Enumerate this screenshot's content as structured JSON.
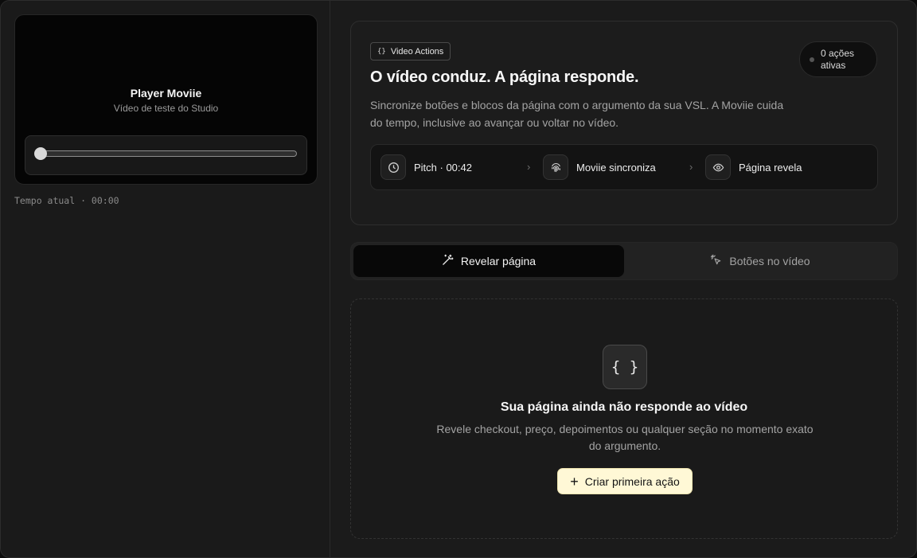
{
  "player": {
    "title": "Player Moviie",
    "subtitle": "Vídeo de teste do Studio",
    "progress": 0,
    "time_label": "Tempo atual · 00:00"
  },
  "card": {
    "badge_icon": "{}",
    "badge_label": "Video Actions",
    "title": "O vídeo conduz. A página responde.",
    "description": "Sincronize botões e blocos da página com o argumento da sua VSL. A Moviie cuida do tempo, inclusive ao avançar ou voltar no vídeo.",
    "status": "0 ações ativas",
    "flow": [
      {
        "label": "Pitch · 00:42",
        "icon": "clock-icon"
      },
      {
        "label": "Moviie sincroniza",
        "icon": "fingerprint-icon"
      },
      {
        "label": "Página revela",
        "icon": "eye-icon"
      }
    ]
  },
  "tabs": [
    {
      "label": "Revelar página",
      "icon": "magic-wand-icon",
      "active": true
    },
    {
      "label": "Botões no vídeo",
      "icon": "pointer-click-icon",
      "active": false
    }
  ],
  "empty": {
    "icon": "{ }",
    "title": "Sua página ainda não responde ao vídeo",
    "description": "Revele checkout, preço, depoimentos ou qualquer seção no momento exato do argumento.",
    "cta_label": "Criar primeira ação"
  }
}
